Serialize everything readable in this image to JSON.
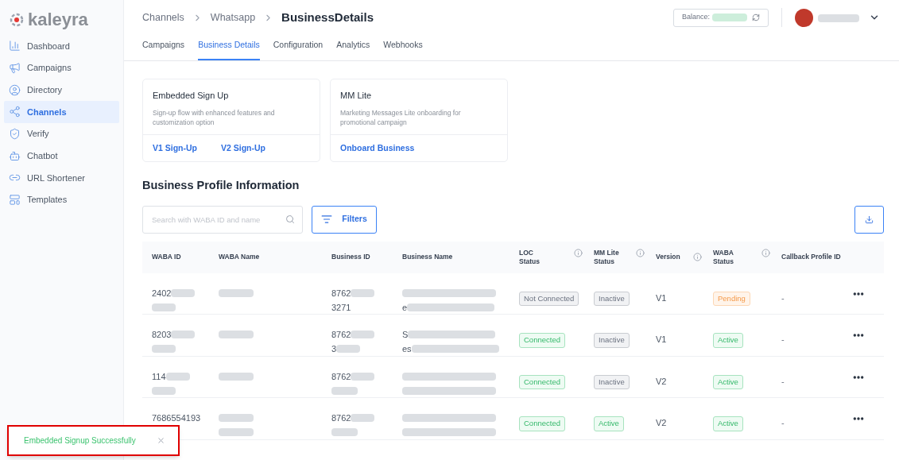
{
  "brand": {
    "name": "kaleyra"
  },
  "sidebar": {
    "items": [
      {
        "label": "Dashboard",
        "selected": false
      },
      {
        "label": "Campaigns",
        "selected": false
      },
      {
        "label": "Directory",
        "selected": false
      },
      {
        "label": "Channels",
        "selected": true
      },
      {
        "label": "Verify",
        "selected": false
      },
      {
        "label": "Chatbot",
        "selected": false
      },
      {
        "label": "URL Shortener",
        "selected": false
      },
      {
        "label": "Templates",
        "selected": false
      }
    ]
  },
  "breadcrumb": [
    "Channels",
    "Whatsapp",
    "BusinessDetails"
  ],
  "balance": {
    "label": "Balance:",
    "redacted": true
  },
  "user": {
    "redacted": true
  },
  "tabs": [
    {
      "label": "Campaigns",
      "selected": false
    },
    {
      "label": "Business Details",
      "selected": true
    },
    {
      "label": "Configuration",
      "selected": false
    },
    {
      "label": "Analytics",
      "selected": false
    },
    {
      "label": "Webhooks",
      "selected": false
    }
  ],
  "cards": [
    {
      "title": "Embedded Sign Up",
      "description": "Sign-up flow with enhanced features and customization option",
      "links": [
        "V1 Sign-Up",
        "V2 Sign-Up"
      ]
    },
    {
      "title": "MM Lite",
      "description": "Marketing Messages Lite onboarding for promotional campaign",
      "links": [
        "Onboard Business"
      ]
    }
  ],
  "section_title": "Business Profile Information",
  "search": {
    "placeholder": "Search with WABA ID and name"
  },
  "filters_button": "Filters",
  "table": {
    "columns": [
      {
        "label": "WABA ID",
        "info": false
      },
      {
        "label": "WABA Name",
        "info": false
      },
      {
        "label": "Business ID",
        "info": false
      },
      {
        "label": "Business Name",
        "info": false
      },
      {
        "label": "LOC Status",
        "info": true
      },
      {
        "label": "MM Lite Status",
        "info": true
      },
      {
        "label": "Version",
        "info": true
      },
      {
        "label": "WABA Status",
        "info": true
      },
      {
        "label": "Callback Profile ID",
        "info": false
      }
    ],
    "rows": [
      {
        "waba_id": [
          {
            "text": "2402",
            "redacted": true
          },
          {
            "redacted": true
          }
        ],
        "waba_name": [
          {
            "redacted": true
          }
        ],
        "business_id": [
          {
            "text": "8762",
            "redacted": true
          },
          {
            "text": "3271",
            "redacted": false
          }
        ],
        "business_name": [
          {
            "redacted": true
          },
          {
            "text": "e",
            "redacted": true
          }
        ],
        "loc_status": {
          "text": "Not Connected",
          "kind": "neutral"
        },
        "mm_lite_status": {
          "text": "Inactive",
          "kind": "neutral"
        },
        "version": "V1",
        "waba_status": {
          "text": "Pending",
          "kind": "warning"
        },
        "callback_profile_id": "-"
      },
      {
        "waba_id": [
          {
            "text": "8203",
            "redacted": true
          },
          {
            "redacted": true
          }
        ],
        "waba_name": [
          {
            "redacted": true
          }
        ],
        "business_id": [
          {
            "text": "8762",
            "redacted": true
          },
          {
            "text": "3",
            "redacted": true
          }
        ],
        "business_name": [
          {
            "text": "S",
            "redacted": true
          },
          {
            "text": "es",
            "redacted": true
          }
        ],
        "loc_status": {
          "text": "Connected",
          "kind": "success"
        },
        "mm_lite_status": {
          "text": "Inactive",
          "kind": "neutral"
        },
        "version": "V1",
        "waba_status": {
          "text": "Active",
          "kind": "success"
        },
        "callback_profile_id": "-"
      },
      {
        "waba_id": [
          {
            "text": "114",
            "redacted": true
          },
          {
            "redacted": true
          }
        ],
        "waba_name": [
          {
            "redacted": true
          }
        ],
        "business_id": [
          {
            "text": "8762",
            "redacted": true
          },
          {
            "redacted": true
          }
        ],
        "business_name": [
          {
            "redacted": true
          },
          {
            "redacted": true
          }
        ],
        "loc_status": {
          "text": "Connected",
          "kind": "success"
        },
        "mm_lite_status": {
          "text": "Inactive",
          "kind": "neutral"
        },
        "version": "V2",
        "waba_status": {
          "text": "Active",
          "kind": "success"
        },
        "callback_profile_id": "-"
      },
      {
        "waba_id": [
          {
            "text": "7686554193",
            "redacted": false
          }
        ],
        "waba_name": [
          {
            "redacted": true
          },
          {
            "redacted": true
          }
        ],
        "business_id": [
          {
            "text": "8762",
            "redacted": true
          },
          {
            "redacted": true
          }
        ],
        "business_name": [
          {
            "redacted": true
          },
          {
            "redacted": true
          }
        ],
        "loc_status": {
          "text": "Connected",
          "kind": "success"
        },
        "mm_lite_status": {
          "text": "Active",
          "kind": "success"
        },
        "version": "V2",
        "waba_status": {
          "text": "Active",
          "kind": "success"
        },
        "callback_profile_id": "-"
      }
    ]
  },
  "toast": {
    "message": "Embedded Signup Successfully"
  }
}
